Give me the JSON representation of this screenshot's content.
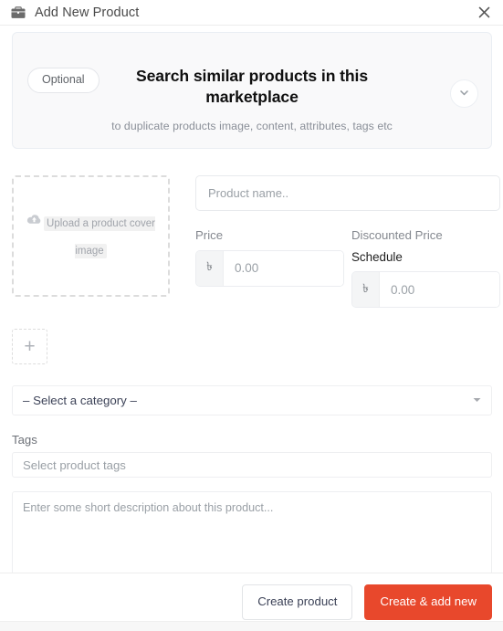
{
  "window": {
    "title": "Add New Product",
    "icon": "briefcase-icon",
    "close_icon": "close-icon"
  },
  "promo": {
    "pill_label": "Optional",
    "title": "Search similar products in this marketplace",
    "subtitle": "to duplicate products image, content, attributes, tags etc",
    "caret_icon": "chevron-down-icon"
  },
  "form": {
    "dropzone": {
      "icon": "cloud-upload-icon",
      "text": "Upload a product cover image"
    },
    "product_name": {
      "value": "",
      "placeholder": "Product name.."
    },
    "price": {
      "label": "Price",
      "currency": "৳",
      "value": "",
      "placeholder": "0.00"
    },
    "discounted_price": {
      "label": "Discounted Price",
      "schedule_label": "Schedule",
      "currency": "৳",
      "value": "",
      "placeholder": "0.00"
    },
    "add_image_button": {
      "label": "+"
    },
    "category": {
      "selected": "– Select a category –",
      "caret_icon": "chevron-down-icon"
    },
    "tags": {
      "label": "Tags",
      "placeholder": "Select product tags"
    },
    "description": {
      "value": "",
      "placeholder": "Enter some short description about this product..."
    }
  },
  "footer": {
    "secondary_label": "Create product",
    "primary_label": "Create & add new"
  },
  "colors": {
    "primary": "#e8482c",
    "banner_bg": "#f9f9fa",
    "text": "#3c4257",
    "muted": "#9aa0a6"
  }
}
